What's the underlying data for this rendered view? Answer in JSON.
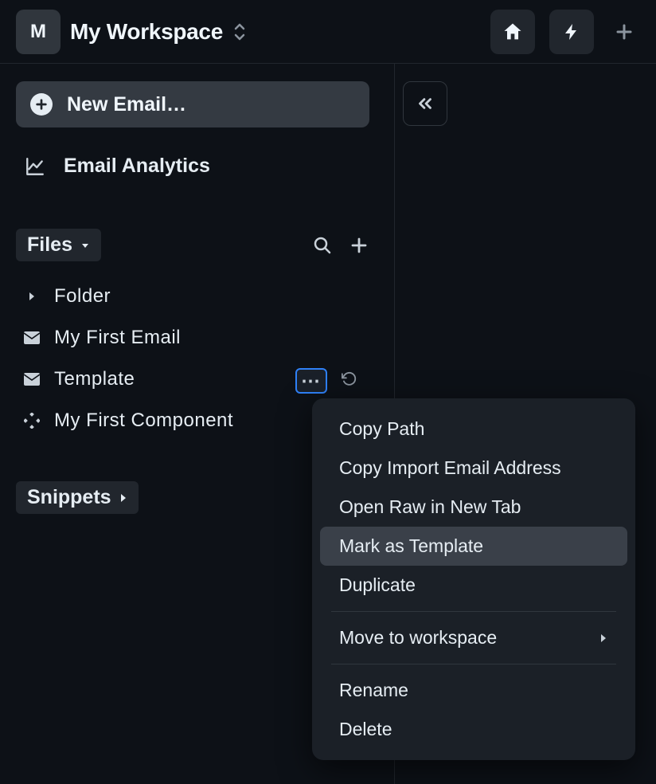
{
  "workspace": {
    "badge": "M",
    "name": "My Workspace"
  },
  "sidebar": {
    "new_email_label": "New Email…",
    "nav": {
      "analytics": "Email Analytics"
    },
    "files": {
      "label": "Files",
      "items": [
        {
          "label": "Folder",
          "type": "folder"
        },
        {
          "label": "My First Email",
          "type": "email"
        },
        {
          "label": "Template",
          "type": "email"
        },
        {
          "label": "My First Component",
          "type": "component"
        }
      ]
    },
    "snippets": {
      "label": "Snippets"
    }
  },
  "context_menu": {
    "items": [
      {
        "label": "Copy Path"
      },
      {
        "label": "Copy Import Email Address"
      },
      {
        "label": "Open Raw in New Tab"
      },
      {
        "label": "Mark as Template",
        "hover": true
      },
      {
        "label": "Duplicate"
      },
      {
        "sep": true
      },
      {
        "label": "Move to workspace",
        "submenu": true
      },
      {
        "sep": true
      },
      {
        "label": "Rename"
      },
      {
        "label": "Delete"
      }
    ]
  }
}
